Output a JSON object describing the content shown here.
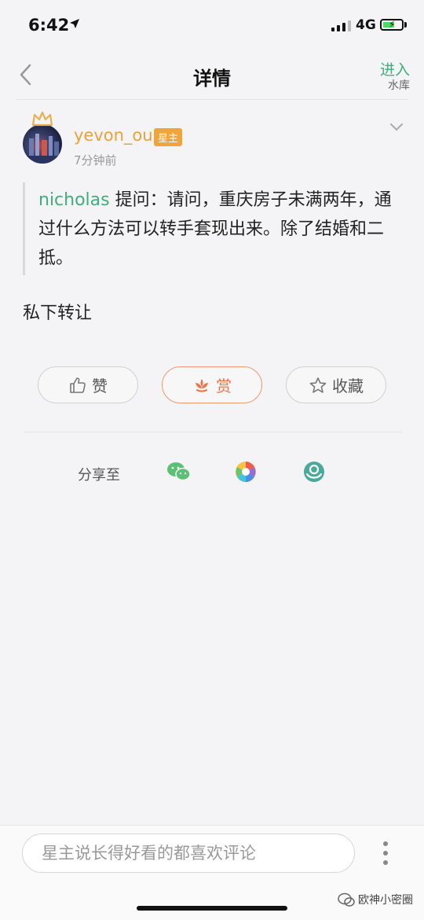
{
  "status_bar": {
    "time": "6:42",
    "network": "4G"
  },
  "nav": {
    "title": "详情",
    "enter_label": "进入",
    "library_label": "水库"
  },
  "post": {
    "author": "yevon_ou",
    "badge": "星主",
    "time": "7分钟前",
    "quote_name": "nicholas",
    "quote_text": " 提问：请问，重庆房子未满两年，通过什么方法可以转手套现出来。除了结婚和二抵。",
    "answer": "私下转让"
  },
  "actions": {
    "like_label": "赞",
    "reward_label": "赏",
    "favorite_label": "收藏"
  },
  "share": {
    "label": "分享至",
    "targets": [
      "wechat-icon",
      "moments-icon",
      "circle-icon"
    ]
  },
  "comment": {
    "placeholder": "星主说长得好看的都喜欢评论"
  },
  "watermark": {
    "label": "欧神小密圈"
  },
  "colors": {
    "accent_green": "#3fae7c",
    "accent_orange": "#e8a23a",
    "reward_orange": "#e9744a"
  }
}
